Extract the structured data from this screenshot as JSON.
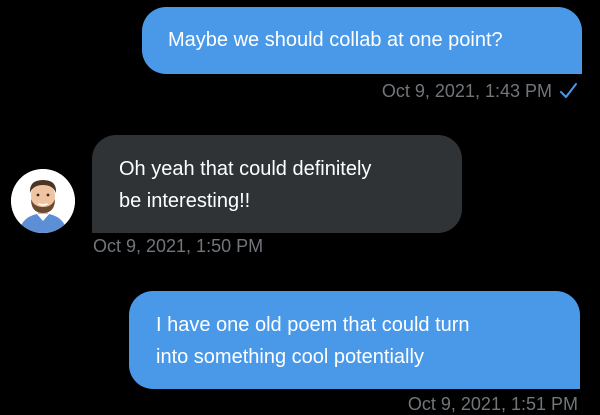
{
  "conversation": {
    "messages": [
      {
        "direction": "outgoing",
        "lines": [
          "Maybe we should collab at one point?"
        ],
        "timestamp": "Oct 9, 2021, 1:43 PM",
        "read_receipt_icon": "checkmark-icon"
      },
      {
        "direction": "incoming",
        "lines": [
          "Oh yeah that could definitely",
          "be interesting!!"
        ],
        "timestamp": "Oct 9, 2021, 1:50 PM",
        "sender_avatar": "avatar"
      },
      {
        "direction": "outgoing",
        "lines": [
          "I have one old poem that could turn",
          "into something cool potentially"
        ],
        "timestamp": "Oct 9, 2021, 1:51 PM"
      }
    ]
  },
  "colors": {
    "background": "#000000",
    "outgoing_bubble": "#4a99e9",
    "incoming_bubble": "#2f3336",
    "timestamp_text": "#71767b",
    "check_icon": "#4a99e9"
  }
}
